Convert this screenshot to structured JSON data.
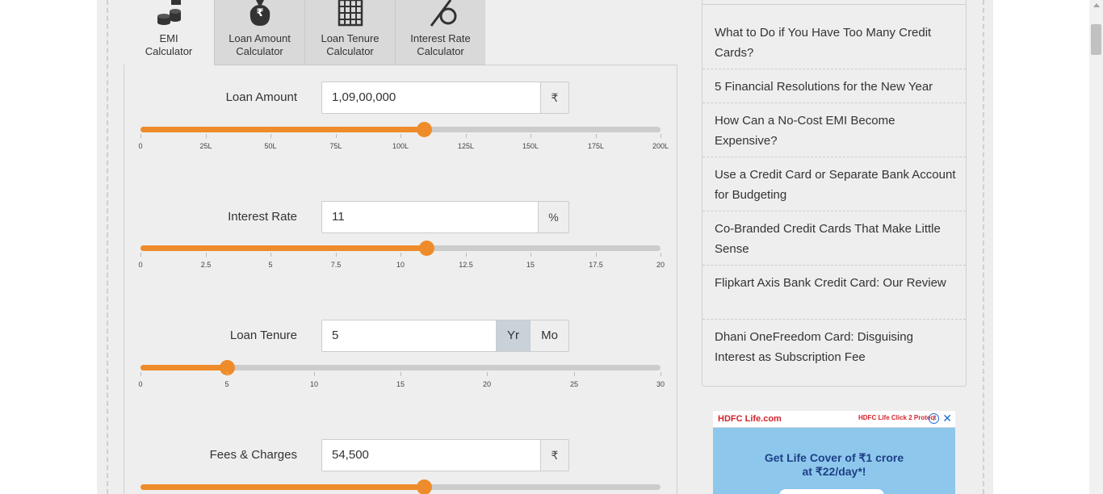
{
  "tabs": [
    {
      "label_line1": "EMI",
      "label_line2": "Calculator",
      "icon": "coins-icon",
      "active": true
    },
    {
      "label_line1": "Loan Amount",
      "label_line2": "Calculator",
      "icon": "rupee-bag-icon",
      "active": false
    },
    {
      "label_line1": "Loan Tenure",
      "label_line2": "Calculator",
      "icon": "calendar-icon",
      "active": false
    },
    {
      "label_line1": "Interest Rate",
      "label_line2": "Calculator",
      "icon": "percent-icon",
      "active": false
    }
  ],
  "rows": {
    "loan_amount": {
      "label": "Loan Amount",
      "value": "1,09,00,000",
      "unit": "₹",
      "slider_fraction": 0.545,
      "ticks": [
        "0",
        "25L",
        "50L",
        "75L",
        "100L",
        "125L",
        "150L",
        "175L",
        "200L"
      ]
    },
    "interest_rate": {
      "label": "Interest Rate",
      "value": "11",
      "unit": "%",
      "slider_fraction": 0.55,
      "ticks": [
        "0",
        "2.5",
        "5",
        "7.5",
        "10",
        "12.5",
        "15",
        "17.5",
        "20"
      ]
    },
    "loan_tenure": {
      "label": "Loan Tenure",
      "value": "5",
      "unit_yr": "Yr",
      "unit_mo": "Mo",
      "selected_unit": "Yr",
      "slider_fraction": 0.1667,
      "ticks": [
        "0",
        "5",
        "10",
        "15",
        "20",
        "25",
        "30"
      ]
    },
    "fees": {
      "label": "Fees & Charges",
      "value": "54,500",
      "unit": "₹",
      "slider_fraction": 0.545
    }
  },
  "sidebar": {
    "articles": [
      "What to Do if You Have Too Many Credit Cards?",
      "5 Financial Resolutions for the New Year",
      "How Can a No-Cost EMI Become Expensive?",
      "Use a Credit Card or Separate Bank Account for Budgeting",
      "Co-Branded Credit Cards That Make Little Sense",
      "Flipkart Axis Bank Credit Card: Our Review",
      "Dhani OneFreedom Card: Disguising Interest as Subscription Fee"
    ]
  },
  "ad": {
    "logo": "HDFC Life.com",
    "logo2": "HDFC Life Click 2 Protect",
    "headline1": "Get Life Cover of ₹1 crore",
    "headline2": "at ₹22/day*!",
    "info": "i",
    "close": "✕"
  },
  "colors": {
    "accent": "#ee8c2b",
    "track": "#cccccc",
    "ad_bg": "#8ec7ec",
    "ad_text": "#1d3f86"
  }
}
